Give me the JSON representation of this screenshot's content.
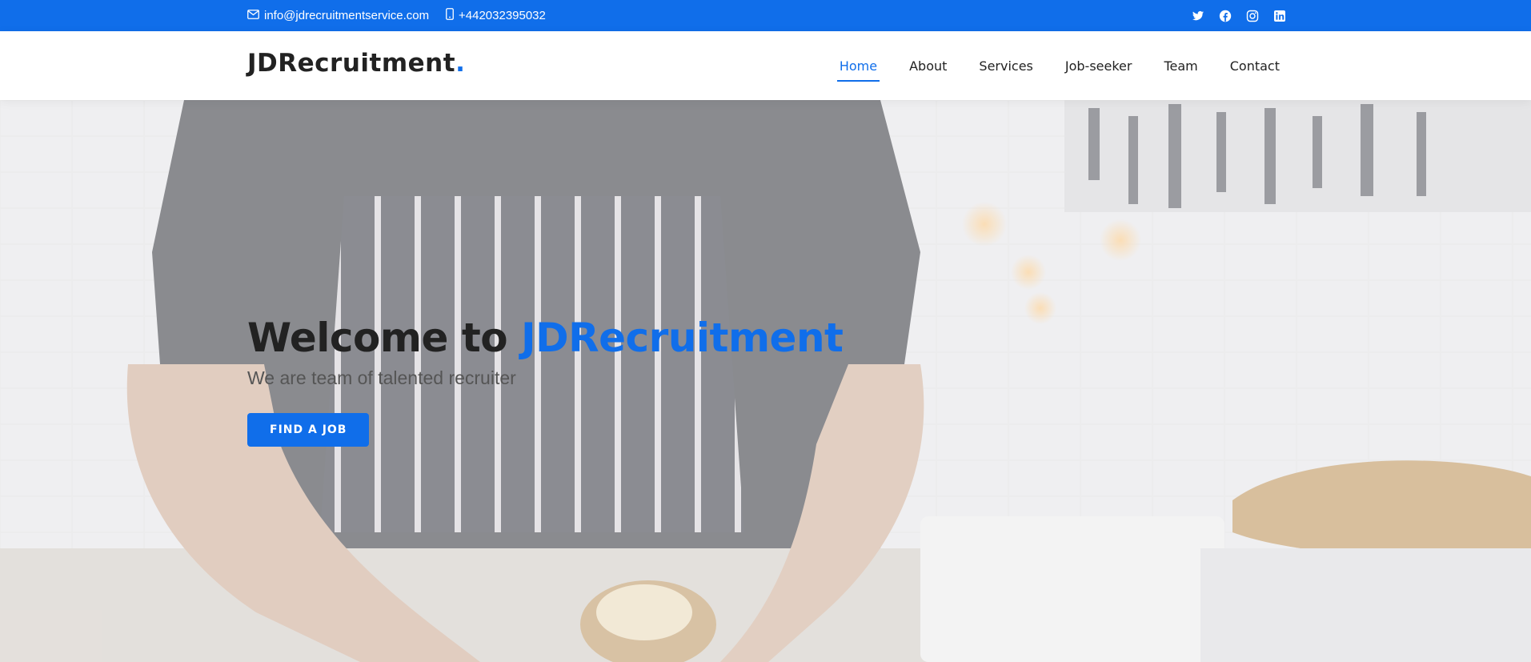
{
  "topbar": {
    "email": "info@jdrecruitmentservice.com",
    "phone": "+442032395032",
    "email_icon": "envelope-icon",
    "phone_icon": "phone-icon",
    "socials": [
      "twitter-icon",
      "facebook-icon",
      "instagram-icon",
      "linkedin-icon"
    ]
  },
  "header": {
    "logo_text": "JDRecruitment",
    "logo_dot": ".",
    "nav": [
      {
        "label": "Home",
        "active": true
      },
      {
        "label": "About"
      },
      {
        "label": "Services"
      },
      {
        "label": "Job-seeker"
      },
      {
        "label": "Team"
      },
      {
        "label": "Contact"
      }
    ]
  },
  "hero": {
    "title_prefix": "Welcome to ",
    "title_brand": "JDRecruitment",
    "subtitle": "We are team of talented recruiter",
    "cta_label": "FIND A JOB"
  },
  "colors": {
    "accent": "#106eea",
    "text_dark": "#222222",
    "text_muted": "#555555"
  }
}
